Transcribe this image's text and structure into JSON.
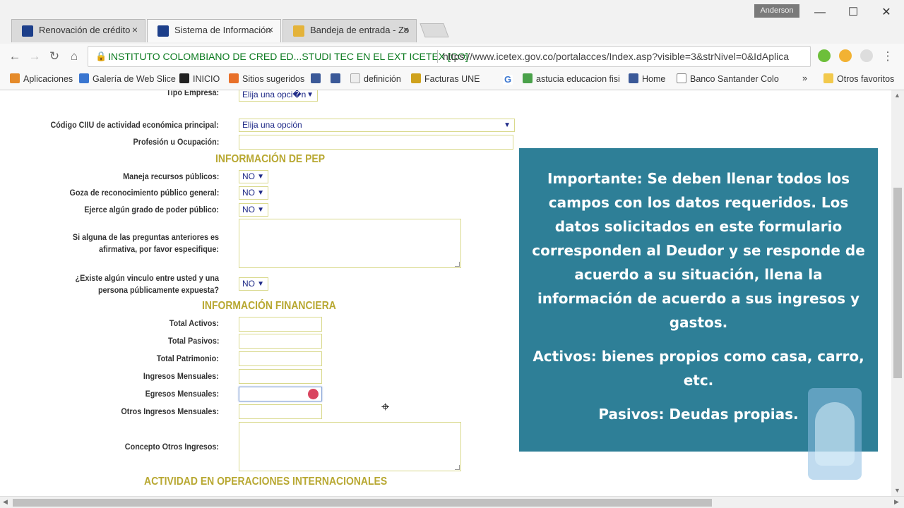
{
  "browser": {
    "tabs": [
      {
        "title": "Renovación de crédito",
        "close": "×"
      },
      {
        "title": "Sistema de Información",
        "close": "×"
      },
      {
        "title": "Bandeja de entrada - Zo",
        "close": "×"
      }
    ],
    "user": "Anderson",
    "site_identity": "INSTITUTO COLOMBIANO DE CRED ED...STUDI TEC EN EL EXT ICETEX [CO]",
    "url": "https://www.icetex.gov.co/portalacces/Index.asp?visible=3&strNivel=0&IdAplica",
    "bookmarks": [
      "Aplicaciones",
      "Galería de Web Slice",
      "INICIO",
      "Sitios sugeridos",
      "definición",
      "Facturas UNE",
      "astucia educacion fisi",
      "Home",
      "Banco Santander Colo"
    ],
    "more_bookmarks": "»",
    "other_bookmarks": "Otros favoritos"
  },
  "form": {
    "tipo_empresa": {
      "label": "Tipo Empresa:",
      "value": "Elija una opci�n"
    },
    "ciiu": {
      "label": "Código CIIU de actividad económica principal:",
      "value": "Elija una opción"
    },
    "profesion": {
      "label": "Profesión u Ocupación:"
    },
    "pep_heading": "INFORMACIÓN DE PEP",
    "maneja": {
      "label": "Maneja recursos públicos:",
      "value": "NO"
    },
    "goza": {
      "label": "Goza de reconocimiento público general:",
      "value": "NO"
    },
    "ejerce": {
      "label": "Ejerce algún grado de poder público:",
      "value": "NO"
    },
    "especifique": {
      "label": "Si alguna de las preguntas anteriores es afirmativa, por favor especifique:"
    },
    "vinculo": {
      "label": "¿Existe algún vinculo entre usted y una persona públicamente expuesta?",
      "value": "NO"
    },
    "fin_heading": "INFORMACIÓN FINANCIERA",
    "total_activos": "Total Activos:",
    "total_pasivos": "Total Pasivos:",
    "total_patrimonio": "Total Patrimonio:",
    "ingresos": "Ingresos Mensuales:",
    "egresos": "Egresos Mensuales:",
    "otros_ingresos": "Otros Ingresos Mensuales:",
    "concepto": "Concepto Otros Ingresos:",
    "intl_heading": "ACTIVIDAD EN OPERACIONES INTERNACIONALES"
  },
  "overlay": {
    "p1": "Importante: Se deben llenar todos los campos con los datos requeridos. Los datos solicitados en este formulario corresponden al Deudor y se responde de acuerdo a su situación,  llena la información de acuerdo a sus ingresos y gastos.",
    "p2": "Activos: bienes propios como casa, carro, etc.",
    "p3": "Pasivos: Deudas propias."
  },
  "colors": {
    "overlay_bg": "#2e7f97",
    "section_heading": "#b8a832",
    "select_text": "#1f2a88"
  }
}
